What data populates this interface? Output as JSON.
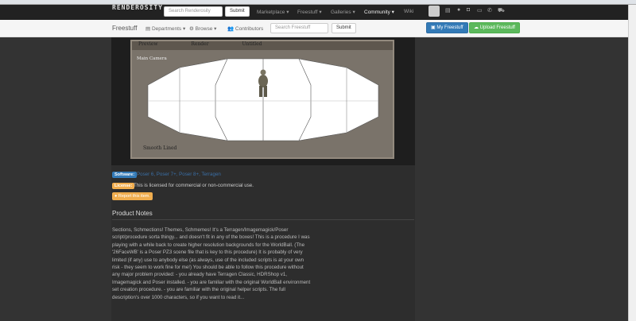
{
  "nav": {
    "logo": "RENDEROSITY",
    "search_placeholder": "Search Renderosity",
    "submit": "Submit",
    "links": [
      "Marketplace ▾",
      "Freestuff ▾",
      "Galleries ▾",
      "Community ▾",
      "Wiki"
    ]
  },
  "subnav": {
    "title": "Freestuff",
    "departments": "Departments ▾",
    "browse": "Browse ▾",
    "contributors": "Contributors",
    "search_placeholder": "Search Freestuff",
    "submit": "Submit",
    "my_freestuff": "My Freestuff",
    "upload": "Upload Freestuff"
  },
  "preview": {
    "tabs": [
      "Preview",
      "Render",
      "Untitled"
    ],
    "camera": "Main Camera",
    "style": "Smooth Lined"
  },
  "software": {
    "label": "Software:",
    "value": "Poser 6, Poser 7+, Poser 8+, Terragen"
  },
  "license": {
    "label": "License:",
    "value": "This is licensed for commercial or non-commercial use."
  },
  "report": "Report this item.",
  "notes": {
    "title": "Product Notes",
    "text": "Sections, Schmections! Themes, Schmemes! It's a Terragen/Imagemagick/Poser script/procedure sorta thingy... and doesn't fit in any of the boxes! This is a procedure I was playing with a while back to create higher resolution backgrounds for the WorldBall. (The '26FaceWB' is a Poser PZ3 scene file that is key to this procedure) It is probably of very limited (if any) use to anybody else (as always, use of the included scripts is at your own risk - they seem to work fine for me!) You should be able to follow this procedure without any major problem provided: - you already have Terragen Classic, HDRShop v1, Imagemagick and Poser installed. - you are familiar with the original WorldBall environment set creation procedure. - you are familiar with the original helper scripts. The full description's over 1000 characters, so if you want to read it..."
  }
}
